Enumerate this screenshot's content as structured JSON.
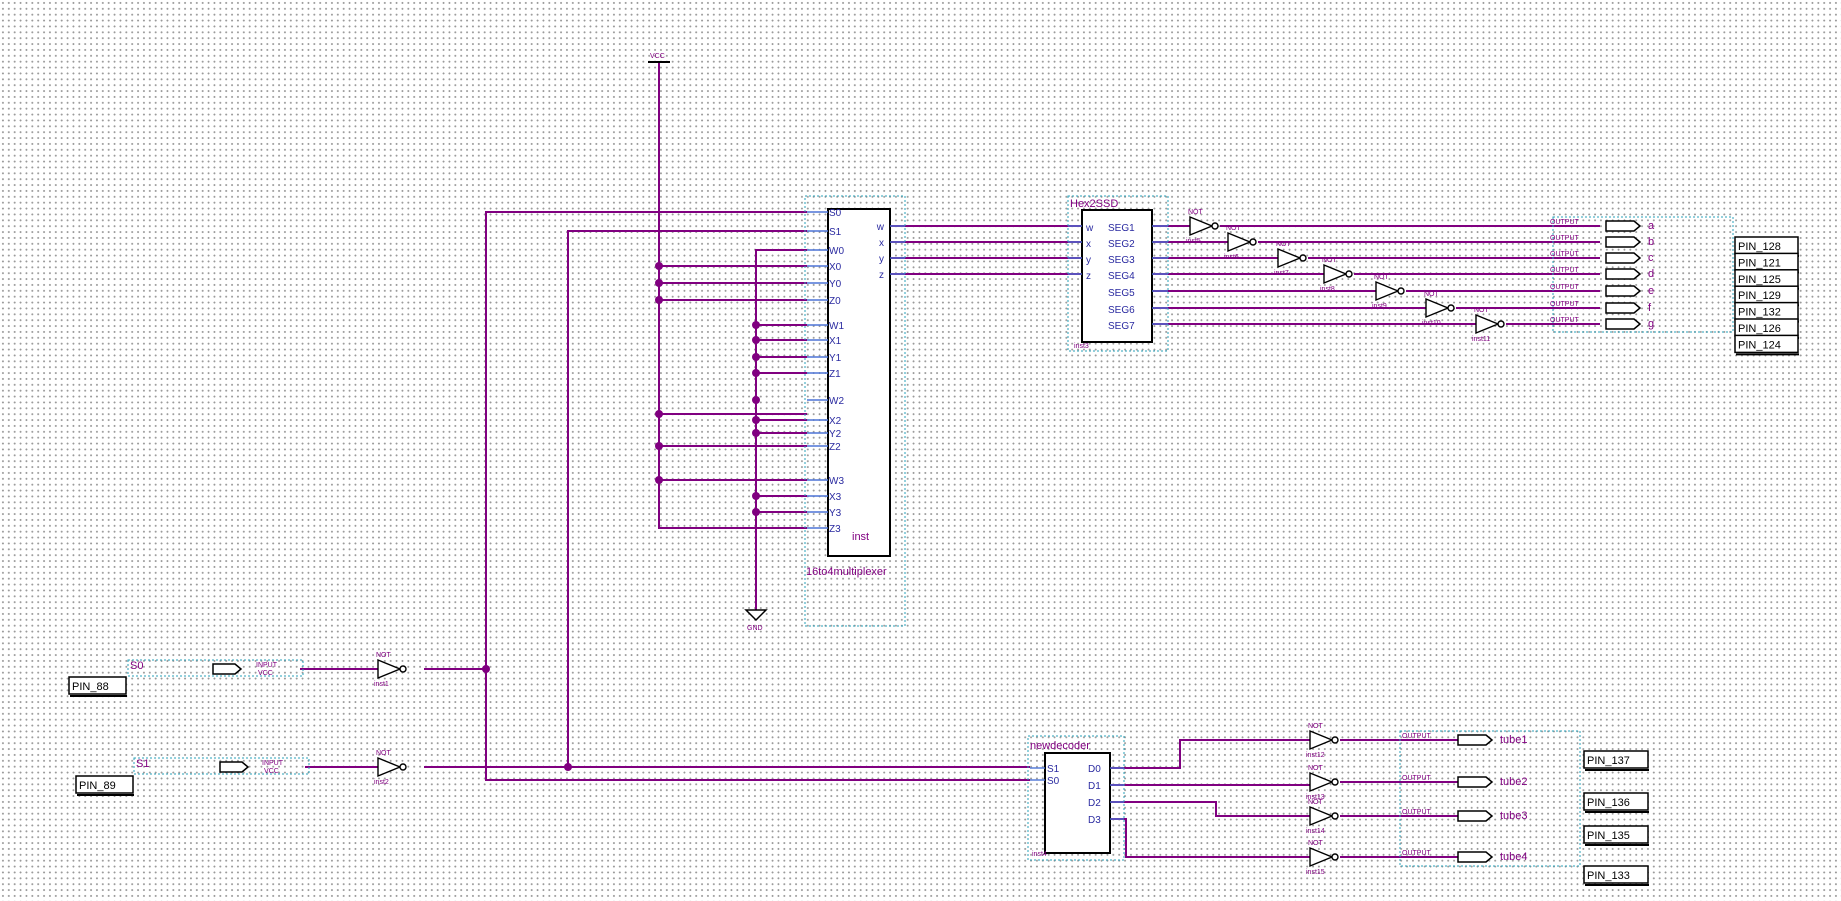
{
  "mux": {
    "title": "16to4multiplexer",
    "inst": "inst",
    "left_pins": [
      "S0",
      "S1",
      "W0",
      "X0",
      "Y0",
      "Z0",
      "W1",
      "X1",
      "Y1",
      "Z1",
      "W2",
      "X2",
      "Y2",
      "Z2",
      "W3",
      "X3",
      "Y3",
      "Z3"
    ],
    "right_pins": [
      "w",
      "x",
      "y",
      "z"
    ]
  },
  "seg": {
    "title": "Hex2SSD",
    "inst": "inst3",
    "left_pins": [
      "w",
      "x",
      "y",
      "z"
    ],
    "right_pins": [
      "SEG1",
      "SEG2",
      "SEG3",
      "SEG4",
      "SEG5",
      "SEG6",
      "SEG7"
    ]
  },
  "dec": {
    "title": "newdecoder",
    "inst": "inst4",
    "left_pins": [
      "S1",
      "S0"
    ],
    "right_pins": [
      "D0",
      "D1",
      "D2",
      "D3"
    ]
  },
  "vcc_label": "VCC",
  "gnd_label": "GND",
  "seg_outputs": [
    "a",
    "b",
    "c",
    "d",
    "e",
    "f",
    "g"
  ],
  "output_prefix": "OUTPUT",
  "tube_outputs": [
    "tube1",
    "tube2",
    "tube3",
    "tube4"
  ],
  "input_names": [
    "S0",
    "S1"
  ],
  "input_prefix": "INPUT",
  "input_vcc": "VCC",
  "not_label": "NOT",
  "pins_seg": [
    "PIN_128",
    "PIN_121",
    "PIN_125",
    "PIN_129",
    "PIN_132",
    "PIN_126",
    "PIN_124"
  ],
  "pins_tube": [
    "PIN_137",
    "PIN_136",
    "PIN_135",
    "PIN_133"
  ],
  "pins_input": [
    "PIN_88",
    "PIN_89"
  ]
}
